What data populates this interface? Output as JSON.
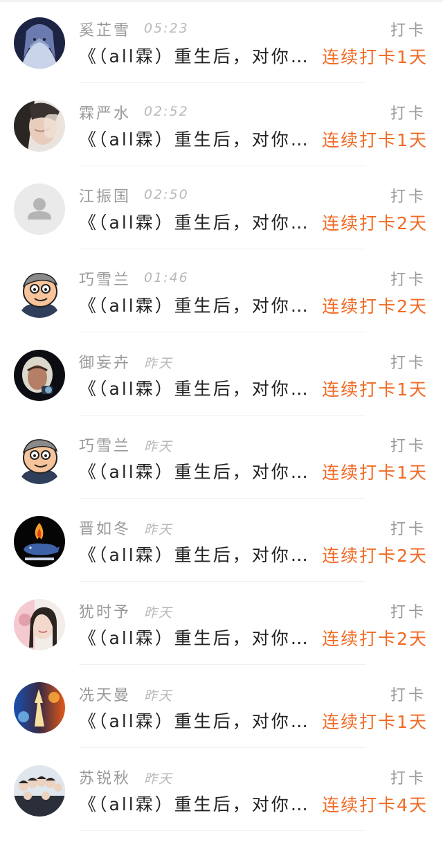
{
  "colors": {
    "accent": "#f06a24",
    "muted_text": "#999999",
    "main_text": "#222222"
  },
  "rows": [
    {
      "name": "奚芷雪",
      "time": "05:23",
      "action": "打卡",
      "content": "《（all霖）重生后，对你的宠爱一如既往》",
      "streak": "连续打卡1天",
      "avatar": "avatar-dark-anime-icon"
    },
    {
      "name": "霖严水",
      "time": "02:52",
      "action": "打卡",
      "content": "《（all霖）重生后，对你的宠爱一如既往》",
      "streak": "连续打卡1天",
      "avatar": "avatar-girl-photo-icon"
    },
    {
      "name": "江振国",
      "time": "02:50",
      "action": "打卡",
      "content": "《（all霖）重生后，对你的宠爱一如既往》",
      "streak": "连续打卡2天",
      "avatar": "default-user-icon"
    },
    {
      "name": "巧雪兰",
      "time": "01:46",
      "action": "打卡",
      "content": "《（all霖）重生后，对你的宠爱一如既往》",
      "streak": "连续打卡2天",
      "avatar": "avatar-cartoon-man-icon"
    },
    {
      "name": "御妄卉",
      "time": "昨天",
      "action": "打卡",
      "content": "《（all霖）重生后，对你的宠爱一如既往》",
      "streak": "连续打卡1天",
      "avatar": "avatar-astronaut-icon"
    },
    {
      "name": "巧雪兰",
      "time": "昨天",
      "action": "打卡",
      "content": "《（all霖）重生后，对你的宠爱一如既往》",
      "streak": "连续打卡1天",
      "avatar": "avatar-cartoon-man-icon"
    },
    {
      "name": "晋如冬",
      "time": "昨天",
      "action": "打卡",
      "content": "《（all霖）重生后，对你的宠爱一如既往》",
      "streak": "连续打卡2天",
      "avatar": "avatar-fire-whale-icon"
    },
    {
      "name": "犹时予",
      "time": "昨天",
      "action": "打卡",
      "content": "《（all霖）重生后，对你的宠爱一如既往》",
      "streak": "连续打卡2天",
      "avatar": "avatar-girl-pink-icon"
    },
    {
      "name": "冼天曼",
      "time": "昨天",
      "action": "打卡",
      "content": "《（all霖）重生后，对你的宠爱一如既往》",
      "streak": "连续打卡1天",
      "avatar": "avatar-fire-ice-icon"
    },
    {
      "name": "苏锐秋",
      "time": "昨天",
      "action": "打卡",
      "content": "《（all霖）重生后，对你的宠爱一如既往》",
      "streak": "连续打卡4天",
      "avatar": "avatar-group-photo-icon"
    }
  ]
}
